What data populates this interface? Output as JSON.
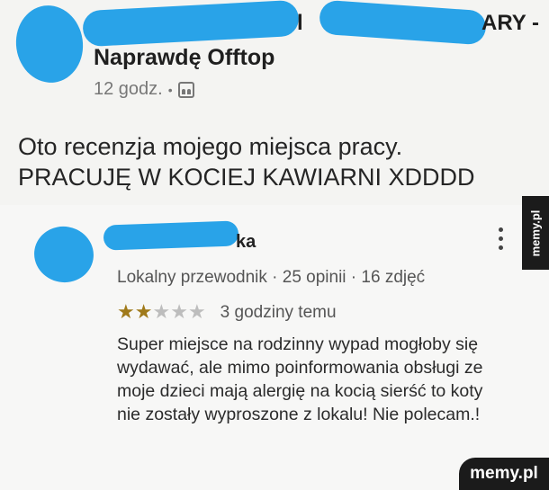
{
  "post": {
    "name_tail_1": "l",
    "name_tail_2": "ARY -",
    "group_name": "Naprawdę Offtop",
    "time": "12 godz.",
    "separator": "•",
    "visibility_icon": "group-icon",
    "text_line1": "Oto recenzja mojego miejsca pracy.",
    "text_line2": "PRACUJĘ W KOCIEJ KAWIARNI XDDDD"
  },
  "review": {
    "reviewer_name_tail": "ka",
    "reviewer_meta": "Lokalny przewodnik · 25 opinii · 16 zdjęć",
    "rating": 2,
    "rating_max": 5,
    "star_on_color": "#a07a1a",
    "star_off_color": "#bdbdbd",
    "time": "3 godziny temu",
    "text": "Super miejsce na rodzinny wypad mogłoby się wydawać, ale mimo poinformowania obsługi ze moje dzieci mają alergię na kocią sierść to koty nie zostały wyproszone z lokalu! Nie polecam.!",
    "more_icon": "more-vertical-icon"
  },
  "watermarks": {
    "side": "memy.pl",
    "bottom": "memy.pl"
  }
}
